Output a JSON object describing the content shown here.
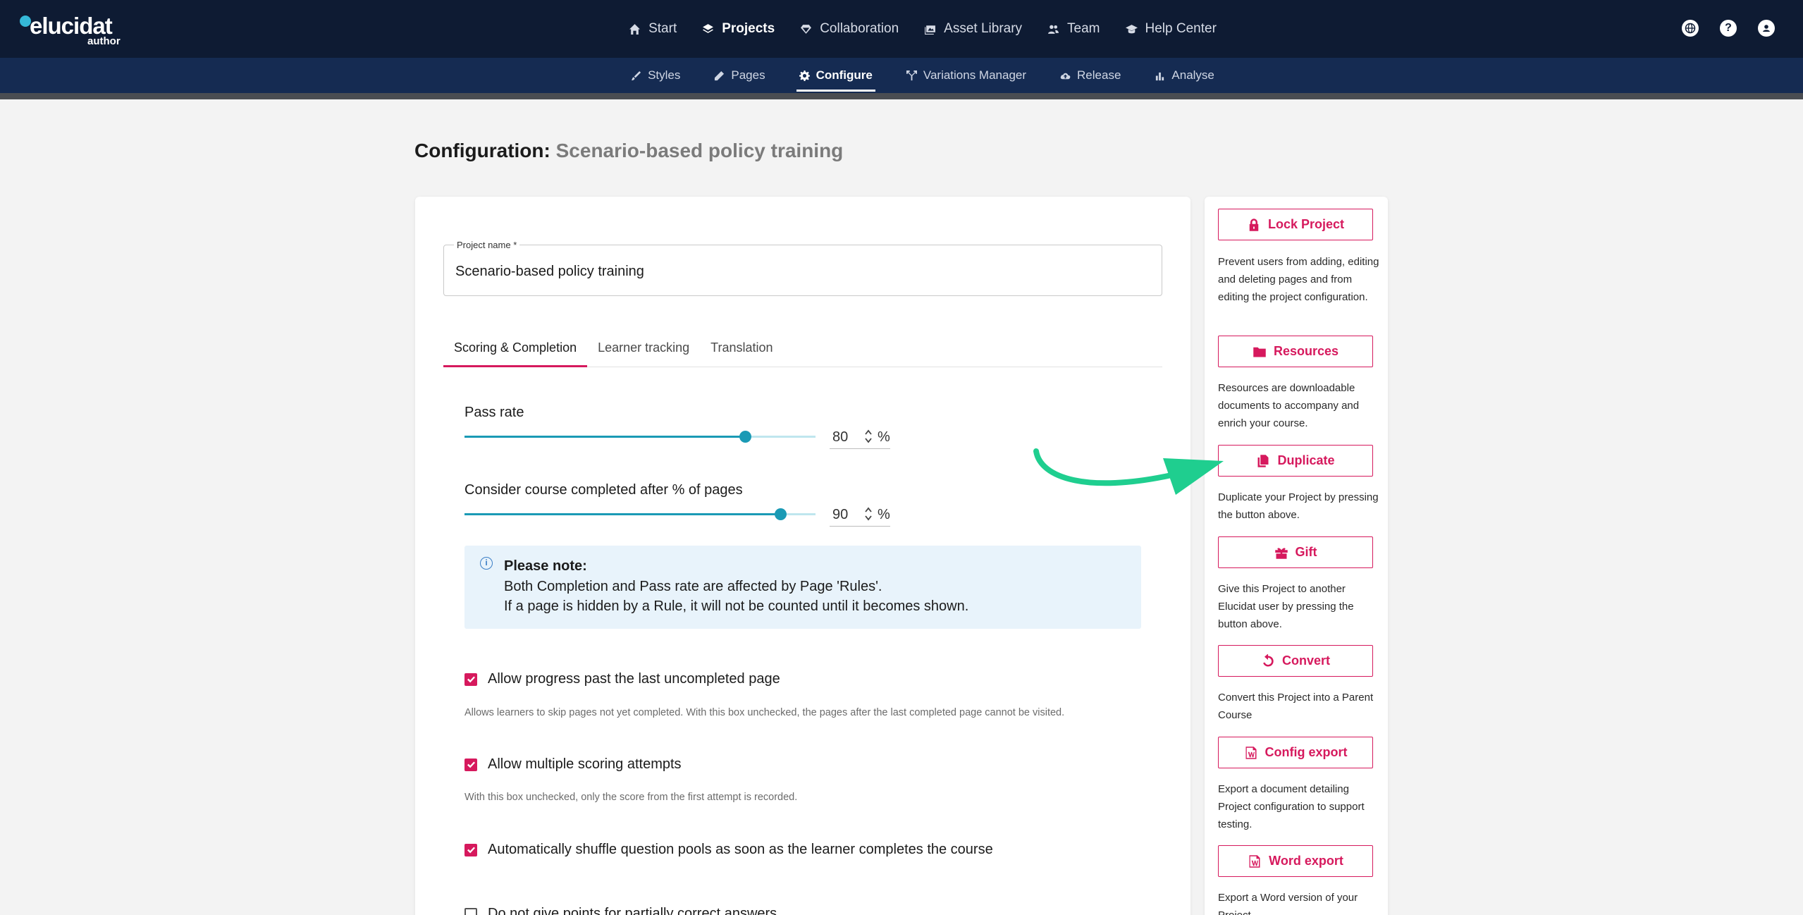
{
  "app": {
    "logo_main": "elucidat",
    "logo_sub": "author"
  },
  "main_nav": [
    {
      "label": "Start",
      "icon": "home-icon",
      "active": false
    },
    {
      "label": "Projects",
      "icon": "layers-icon",
      "active": true
    },
    {
      "label": "Collaboration",
      "icon": "diamond-icon",
      "active": false
    },
    {
      "label": "Asset Library",
      "icon": "images-icon",
      "active": false
    },
    {
      "label": "Team",
      "icon": "people-icon",
      "active": false
    },
    {
      "label": "Help Center",
      "icon": "graduation-cap-icon",
      "active": false
    }
  ],
  "top_icons": [
    "globe-icon",
    "help-icon",
    "account-icon"
  ],
  "sub_nav": [
    {
      "label": "Styles",
      "icon": "brush-icon"
    },
    {
      "label": "Pages",
      "icon": "pencil-icon"
    },
    {
      "label": "Configure",
      "icon": "gear-icon",
      "active": true
    },
    {
      "label": "Variations Manager",
      "icon": "branch-icon"
    },
    {
      "label": "Release",
      "icon": "cloud-upload-icon"
    },
    {
      "label": "Analyse",
      "icon": "bar-chart-icon"
    }
  ],
  "page": {
    "title_prefix": "Configuration:",
    "title_project": "Scenario-based policy training"
  },
  "project_name": {
    "label": "Project name *",
    "value": "Scenario-based policy training"
  },
  "tabs": [
    "Scoring & Completion",
    "Learner tracking",
    "Translation"
  ],
  "pass_rate": {
    "label": "Pass rate",
    "value": "80",
    "unit": "%",
    "fraction": 0.8
  },
  "completion": {
    "label": "Consider course completed after % of pages",
    "value": "90",
    "unit": "%",
    "fraction": 0.9
  },
  "note": {
    "title": "Please note:",
    "line1": "Both Completion and Pass rate are affected by Page 'Rules'.",
    "line2": "If a page is hidden by a Rule, it will not be counted until it becomes shown."
  },
  "options": [
    {
      "label": "Allow progress past the last uncompleted page",
      "checked": true,
      "desc": "Allows learners to skip pages not yet completed. With this box unchecked, the pages after the last completed page cannot be visited."
    },
    {
      "label": "Allow multiple scoring attempts",
      "checked": true,
      "desc": "With this box unchecked, only the score from the first attempt is recorded."
    },
    {
      "label": "Automatically shuffle question pools as soon as the learner completes the course",
      "checked": true,
      "desc": ""
    },
    {
      "label": "Do not give points for partially correct answers",
      "checked": false,
      "desc": ""
    }
  ],
  "side_actions": [
    {
      "label": "Lock Project",
      "icon": "lock-icon",
      "desc": "Prevent users from adding, editing and deleting pages and from editing the project configuration."
    },
    {
      "label": "Resources",
      "icon": "folder-icon",
      "desc": "Resources are downloadable documents to accompany and enrich your course."
    },
    {
      "label": "Duplicate",
      "icon": "copy-icon",
      "desc": "Duplicate your Project by pressing the button above."
    },
    {
      "label": "Gift",
      "icon": "gift-icon",
      "desc": "Give this Project to another Elucidat user by pressing the button above."
    },
    {
      "label": "Convert",
      "icon": "rotate-icon",
      "desc": "Convert this Project into a Parent Course"
    },
    {
      "label": "Config export",
      "icon": "word-doc-icon",
      "desc": "Export a document detailing Project configuration to support testing."
    },
    {
      "label": "Word export",
      "icon": "word-doc-icon",
      "desc": "Export a Word version of your Project."
    }
  ],
  "colors": {
    "nav_bg": "#0e1b33",
    "subnav_bg": "#152b52",
    "accent": "#d6195d",
    "slider": "#1a9ab5",
    "annotation_arrow": "#1fce8f"
  }
}
